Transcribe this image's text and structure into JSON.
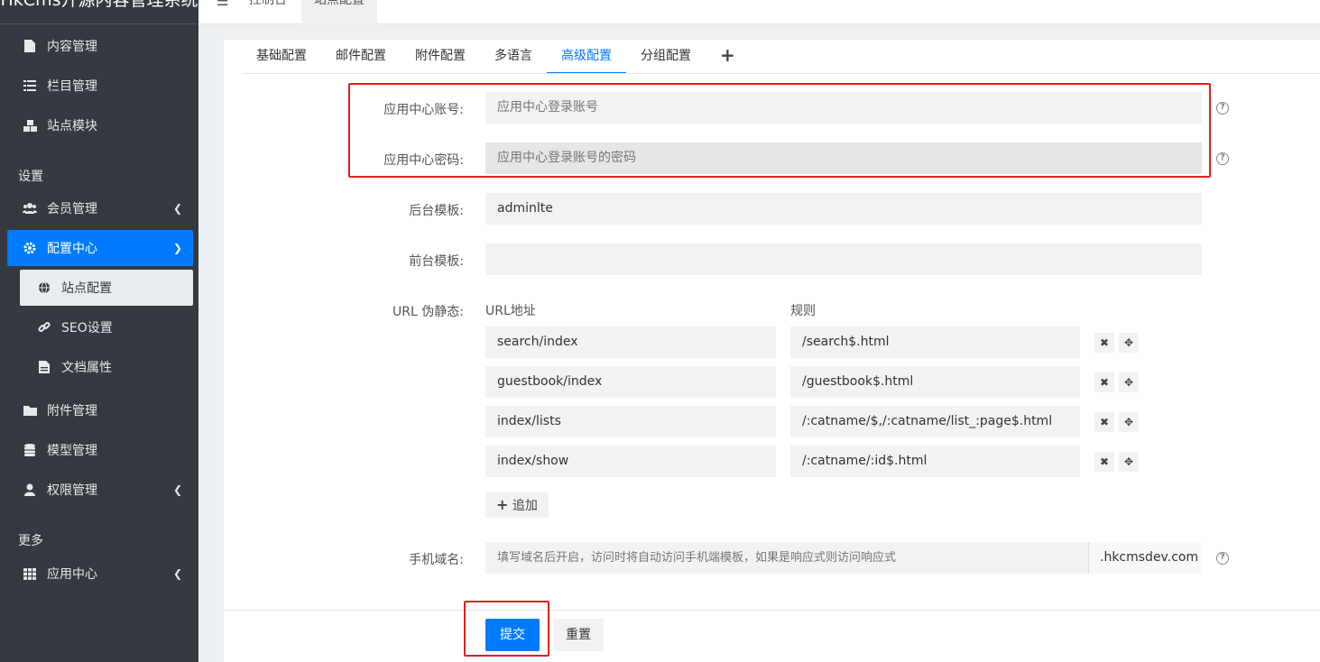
{
  "brand": {
    "title": "HkCms开源内容管理系统"
  },
  "sidebar": {
    "items": [
      {
        "label": "内容管理",
        "icon": "file-icon"
      },
      {
        "label": "栏目管理",
        "icon": "list-icon"
      },
      {
        "label": "站点模块",
        "icon": "cubes-icon"
      }
    ],
    "header_settings": "设置",
    "settings_items": [
      {
        "label": "会员管理",
        "icon": "users-icon"
      },
      {
        "label": "配置中心",
        "icon": "gear-icon"
      },
      {
        "label": "站点配置",
        "icon": "globe-icon"
      },
      {
        "label": "SEO设置",
        "icon": "link-icon"
      },
      {
        "label": "文档属性",
        "icon": "file-text-icon"
      },
      {
        "label": "附件管理",
        "icon": "folder-icon"
      },
      {
        "label": "模型管理",
        "icon": "database-icon"
      },
      {
        "label": "权限管理",
        "icon": "user-icon"
      }
    ],
    "header_more": "更多",
    "more_items": [
      {
        "label": "应用中心",
        "icon": "grid-icon"
      }
    ]
  },
  "topbar": {
    "tabs": [
      "控制台",
      "站点配置"
    ]
  },
  "config_tabs": [
    "基础配置",
    "邮件配置",
    "附件配置",
    "多语言",
    "高级配置",
    "分组配置",
    "+"
  ],
  "form": {
    "app_account": {
      "label": "应用中心账号:",
      "placeholder": "应用中心登录账号"
    },
    "app_password": {
      "label": "应用中心密码:",
      "placeholder": "应用中心登录账号的密码"
    },
    "admin_template": {
      "label": "后台模板:",
      "value": "adminlte"
    },
    "front_template": {
      "label": "前台模板:",
      "value": ""
    },
    "url_rewrite": {
      "label": "URL 伪静态:",
      "col_url": "URL地址",
      "col_rule": "规则",
      "rows": [
        {
          "url": "search/index",
          "rule": "/search$.html"
        },
        {
          "url": "guestbook/index",
          "rule": "/guestbook$.html"
        },
        {
          "url": "index/lists",
          "rule": "/:catname/$,/:catname/list_:page$.html"
        },
        {
          "url": "index/show",
          "rule": "/:catname/:id$.html"
        }
      ],
      "add_label": "追加"
    },
    "mobile_domain": {
      "label": "手机域名:",
      "placeholder": "填写域名后开启，访问时将自动访问手机端模板，如果是响应式则访问响应式",
      "suffix": ".hkcmsdev.com"
    }
  },
  "actions": {
    "submit": "提交",
    "reset": "重置"
  }
}
